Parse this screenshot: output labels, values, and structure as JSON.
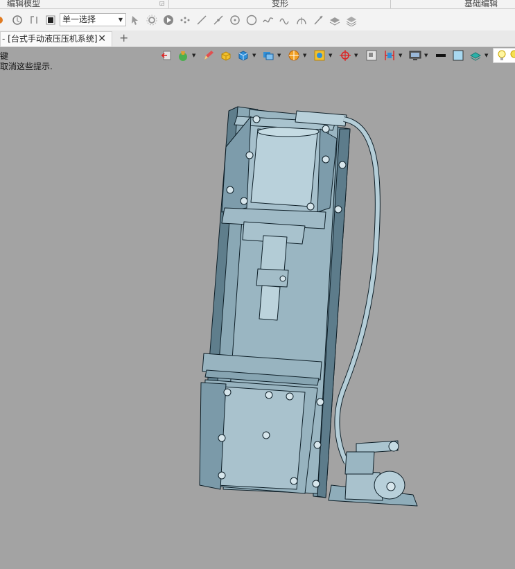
{
  "ribbon": {
    "groups": [
      "编辑模型",
      "变形",
      "基础编辑"
    ]
  },
  "toolbar": {
    "selection_filter": "单一选择",
    "icons": [
      "undo-icon",
      "pick-icon",
      "history-icon",
      "stop-icon",
      "cursor-icon",
      "gear-select-icon",
      "play-icon",
      "points-icon",
      "line-icon",
      "split-line-icon",
      "circle-target-icon",
      "circle-icon",
      "spline-icon",
      "wave-icon",
      "arc-icon",
      "diagonal-icon",
      "layers-icon",
      "layers-stack-icon"
    ]
  },
  "tabs": {
    "document_title": "- [台式手动液压压机系统]",
    "close_glyph": "✕",
    "new_tab_glyph": "+"
  },
  "prompt": {
    "line1": "键",
    "line2": "取消这些提示."
  },
  "view_toolbar": {
    "icons": [
      "exit-icon",
      "render-style-icon",
      "pencil-icon",
      "box-yellow-icon",
      "cube-blue-icon",
      "display-mode-icon",
      "section-icon",
      "view-orient-icon",
      "origin-icon",
      "frame-icon",
      "dimension-icon",
      "monitor-icon",
      "line-weight-icon",
      "color-swatch-icon",
      "layer-icon",
      "light-bulb-icon"
    ]
  },
  "model": {
    "name": "台式手动液压压机系统"
  }
}
